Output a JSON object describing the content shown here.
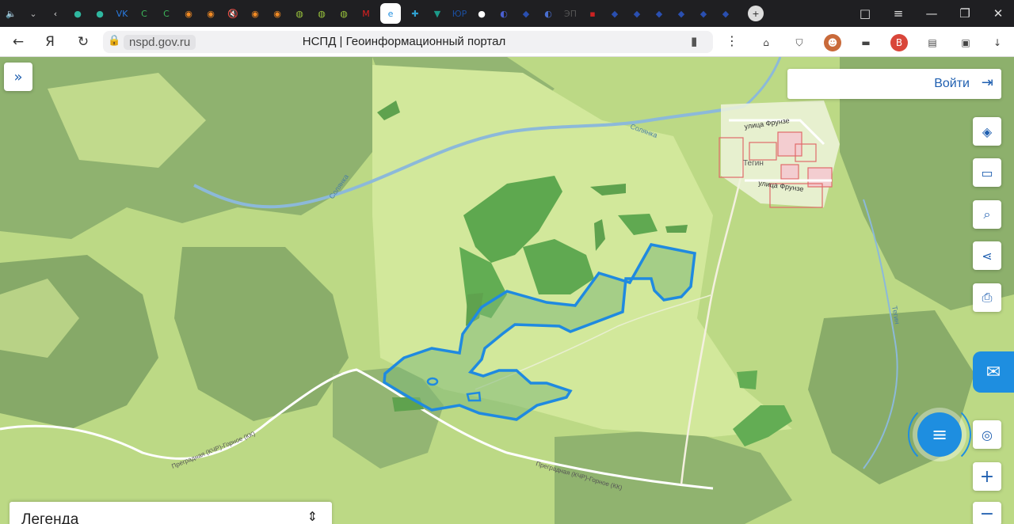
{
  "browser": {
    "tab_icons": [
      "speaker-icon",
      "chevron-down-icon",
      "back-arrow-icon",
      "app-icon",
      "app-icon",
      "vk-icon",
      "app-icon",
      "app-icon",
      "orange-icon",
      "orange-icon",
      "mute-icon",
      "orange-icon",
      "orange-icon",
      "sphere-icon",
      "sphere-icon",
      "sphere-icon",
      "m-icon",
      "active-tab-icon",
      "app-icon",
      "shield-icon",
      "nor-icon",
      "app-icon",
      "app-icon",
      "emblem-icon",
      "app-icon",
      "et-icon",
      "red-icon",
      "emblem-icon",
      "emblem-icon",
      "emblem-icon",
      "emblem-icon",
      "emblem-icon",
      "emblem-icon"
    ],
    "tab_glyphs": [
      "🔈",
      "⌄",
      "‹",
      "●",
      "●",
      "VK",
      "C",
      "C",
      "◉",
      "◉",
      "🔇",
      "◉",
      "◉",
      "◍",
      "◍",
      "◍",
      "M",
      "e",
      "✚",
      "▼",
      "ЮР",
      "●",
      "◐",
      "◆",
      "◐",
      "ЭП",
      "▪",
      "◆",
      "◆",
      "◆",
      "◆",
      "◆",
      "◆"
    ],
    "url_domain": "nspd.gov.ru",
    "page_title": "НСПД | Геоинформационный портал",
    "window_controls": [
      "□",
      "≡",
      "—",
      "❐",
      "✕"
    ]
  },
  "map": {
    "login_label": "Войти",
    "legend_label": "Легенда",
    "labels": {
      "river_1": "Солянка",
      "river_2": "Солянка",
      "street_1": "улица Фрунзе",
      "street_2": "улица Фрунзе",
      "village": "Тегин",
      "road_1": "Преградная (КЧР)-Горное (КК)",
      "road_2": "Преградная (КЧР)-Горное (КК)",
      "stream": "Тегин"
    },
    "tools": [
      "layers-icon",
      "ruler-icon",
      "search-area-icon",
      "share-icon",
      "print-icon",
      "locate-icon",
      "zoom-in-icon",
      "zoom-out-icon"
    ],
    "tool_glyphs": [
      "◈",
      "▭",
      "⌕",
      "⋖",
      "⎙",
      "◎",
      "+",
      "−"
    ],
    "colors": {
      "parcel_outline": "#1f8ae0",
      "forest_dark": "#7fa66a",
      "forest_light": "#a9cc73",
      "meadow": "#cfe69a",
      "parcel_fill": "#7fb877"
    }
  }
}
